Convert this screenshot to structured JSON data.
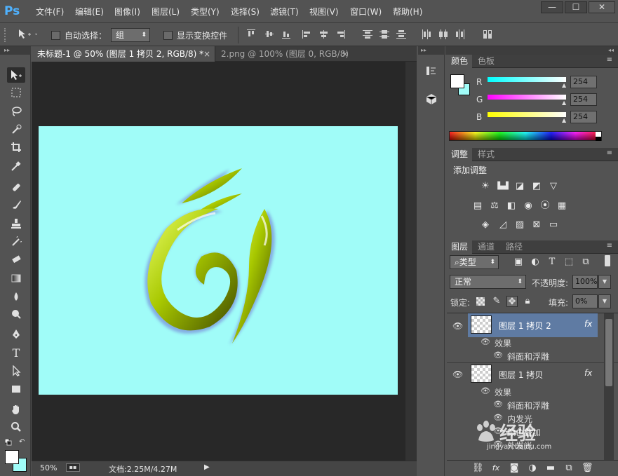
{
  "app": {
    "logo": "Ps"
  },
  "menu": [
    "文件(F)",
    "编辑(E)",
    "图像(I)",
    "图层(L)",
    "类型(Y)",
    "选择(S)",
    "滤镜(T)",
    "视图(V)",
    "窗口(W)",
    "帮助(H)"
  ],
  "window_controls": {
    "minimize": "—",
    "maximize": "☐",
    "close": "✕"
  },
  "options": {
    "auto_select_label": "自动选择：",
    "auto_select_value": "组",
    "show_transform_label": "显示变换控件"
  },
  "tabs": [
    {
      "label": "未标题-1 @ 50% (图层 1 拷贝 2, RGB/8) *",
      "close": "×"
    },
    {
      "label": "2.png @ 100% (图层 0, RGB/8)",
      "close": "×"
    }
  ],
  "status": {
    "zoom": "50%",
    "doc_info": "文档:2.25M/4.27M"
  },
  "color_panel": {
    "tabs": [
      "颜色",
      "色板"
    ],
    "channels": [
      {
        "label": "R",
        "value": "254",
        "color": "#00e5e5"
      },
      {
        "label": "G",
        "value": "254",
        "color": "#e500e5"
      },
      {
        "label": "B",
        "value": "254",
        "color": "#e5e500"
      }
    ]
  },
  "adjust_panel": {
    "tabs": [
      "调整",
      "样式"
    ],
    "title": "添加调整"
  },
  "layers_panel": {
    "tabs": [
      "图层",
      "通道",
      "路径"
    ],
    "filter_kind": "类型",
    "blend_mode": "正常",
    "opacity_label": "不透明度:",
    "opacity_value": "100%",
    "lock_label": "锁定:",
    "fill_label": "填充:",
    "fill_value": "0%",
    "layers": [
      {
        "name": "图层 1 拷贝 2",
        "fx": "fx",
        "effects_label": "效果",
        "effects": [
          "斜面和浮雕"
        ],
        "selected": true
      },
      {
        "name": "图层 1 拷贝",
        "fx": "fx",
        "effects_label": "效果",
        "effects": [
          "斜面和浮雕",
          "内发光",
          "颜色叠加",
          "外发光"
        ],
        "selected": false
      }
    ]
  },
  "watermark": {
    "text": "经验",
    "url": "jingyan.baidu.com"
  },
  "colors": {
    "canvas": "#a0fcf8",
    "accent_blue": "#4fb2ff",
    "glyph_green": "#b8d200"
  }
}
